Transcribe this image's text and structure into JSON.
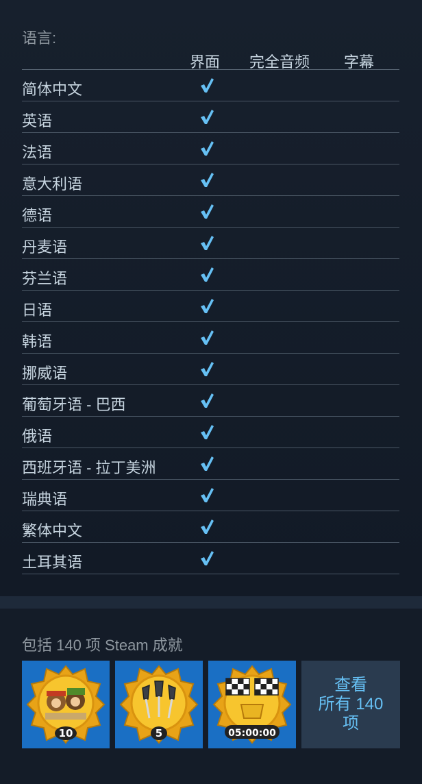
{
  "languages": {
    "title": "语言:",
    "columns": {
      "ui": "界面",
      "audio": "完全音频",
      "subtitles": "字幕"
    },
    "rows": [
      {
        "name": "简体中文",
        "ui": true,
        "audio": false,
        "subtitles": false
      },
      {
        "name": "英语",
        "ui": true,
        "audio": false,
        "subtitles": false
      },
      {
        "name": "法语",
        "ui": true,
        "audio": false,
        "subtitles": false
      },
      {
        "name": "意大利语",
        "ui": true,
        "audio": false,
        "subtitles": false
      },
      {
        "name": "德语",
        "ui": true,
        "audio": false,
        "subtitles": false
      },
      {
        "name": "丹麦语",
        "ui": true,
        "audio": false,
        "subtitles": false
      },
      {
        "name": "芬兰语",
        "ui": true,
        "audio": false,
        "subtitles": false
      },
      {
        "name": "日语",
        "ui": true,
        "audio": false,
        "subtitles": false
      },
      {
        "name": "韩语",
        "ui": true,
        "audio": false,
        "subtitles": false
      },
      {
        "name": "挪威语",
        "ui": true,
        "audio": false,
        "subtitles": false
      },
      {
        "name": "葡萄牙语 - 巴西",
        "ui": true,
        "audio": false,
        "subtitles": false
      },
      {
        "name": "俄语",
        "ui": true,
        "audio": false,
        "subtitles": false
      },
      {
        "name": "西班牙语 - 拉丁美洲",
        "ui": true,
        "audio": false,
        "subtitles": false
      },
      {
        "name": "瑞典语",
        "ui": true,
        "audio": false,
        "subtitles": false
      },
      {
        "name": "繁体中文",
        "ui": true,
        "audio": false,
        "subtitles": false
      },
      {
        "name": "土耳其语",
        "ui": true,
        "audio": false,
        "subtitles": false
      }
    ],
    "check_color": "#66c0f4"
  },
  "achievements": {
    "title": "包括 140 项 Steam 成就",
    "items": [
      {
        "icon": "monkeys-badge-icon",
        "badge": "10"
      },
      {
        "icon": "darts-badge-icon",
        "badge": "5"
      },
      {
        "icon": "race-flags-trophy-icon",
        "badge": "05:00:00"
      }
    ],
    "view_all": {
      "line1": "查看",
      "line2": "所有 140",
      "line3": "项"
    },
    "tile_color": "#1a6fc4"
  }
}
